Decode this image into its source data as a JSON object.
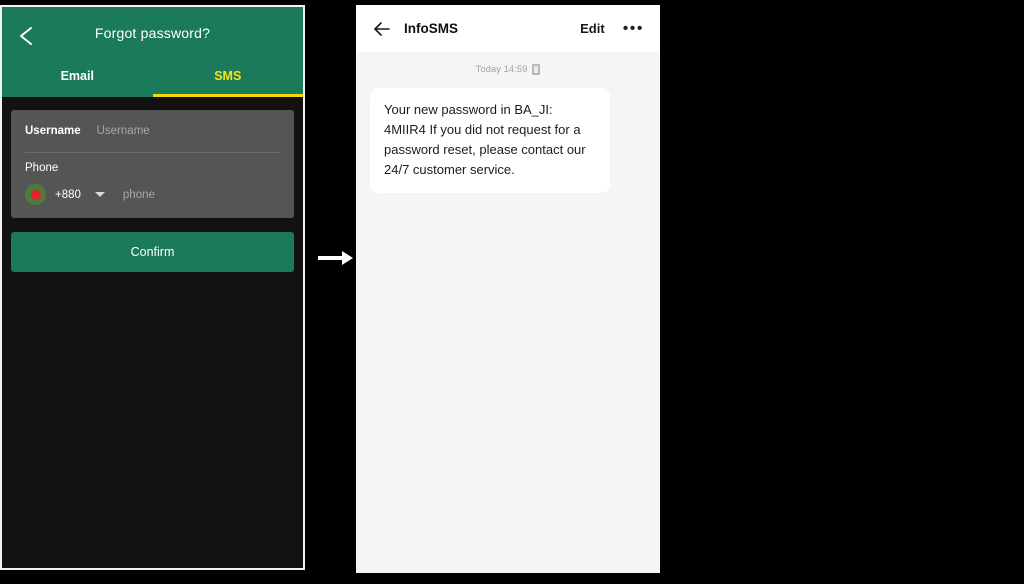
{
  "left_screen": {
    "header": {
      "back_icon": "chevron-left-icon",
      "title": "Forgot password?"
    },
    "tabs": [
      {
        "label": "Email",
        "active": false
      },
      {
        "label": "SMS",
        "active": true
      }
    ],
    "form": {
      "username": {
        "label": "Username",
        "placeholder": "Username",
        "value": ""
      },
      "phone": {
        "label": "Phone",
        "flag_icon": "bangladesh-flag-icon",
        "dial_code": "+880",
        "dropdown_icon": "chevron-down-icon",
        "placeholder": "phone",
        "value": ""
      }
    },
    "confirm_label": "Confirm"
  },
  "flow": {
    "arrow_icon": "arrow-right-icon"
  },
  "right_screen": {
    "header": {
      "back_icon": "arrow-left-icon",
      "title": "InfoSMS",
      "edit_label": "Edit",
      "more_label": "•••"
    },
    "conversation": {
      "timestamp": "Today 14:59",
      "sim_icon": "sim-card-icon",
      "messages": [
        {
          "text": "Your new password in BA_JI: 4MIIR4  If you did not request for a password reset, please contact our 24/7 customer service."
        }
      ]
    }
  },
  "colors": {
    "brand_green": "#1b7a5a",
    "accent_yellow": "#f2d90b",
    "card_gray": "#555555",
    "page_black": "#000000",
    "sms_background": "#f5f5f5"
  }
}
